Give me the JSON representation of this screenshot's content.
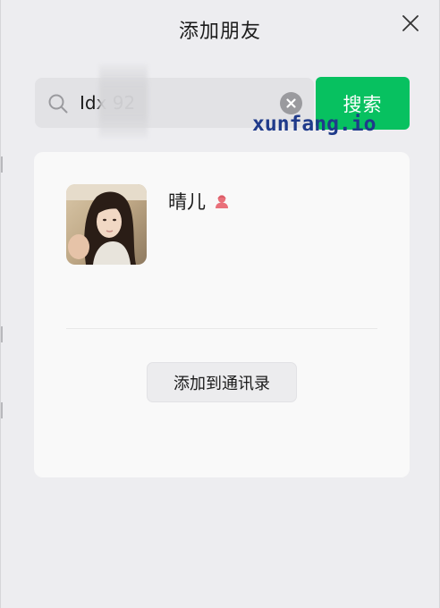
{
  "dialog": {
    "title": "添加朋友"
  },
  "search": {
    "value": "Idx 92",
    "button_label": "搜索"
  },
  "watermark": "xunfang.io",
  "result": {
    "name": "晴儿",
    "gender": "female",
    "add_button_label": "添加到通讯录"
  },
  "colors": {
    "accent": "#07c160",
    "female_icon": "#e9707a",
    "watermark": "#1f3a8a"
  },
  "icons": [
    "close-icon",
    "search-icon",
    "clear-icon",
    "female-icon"
  ]
}
